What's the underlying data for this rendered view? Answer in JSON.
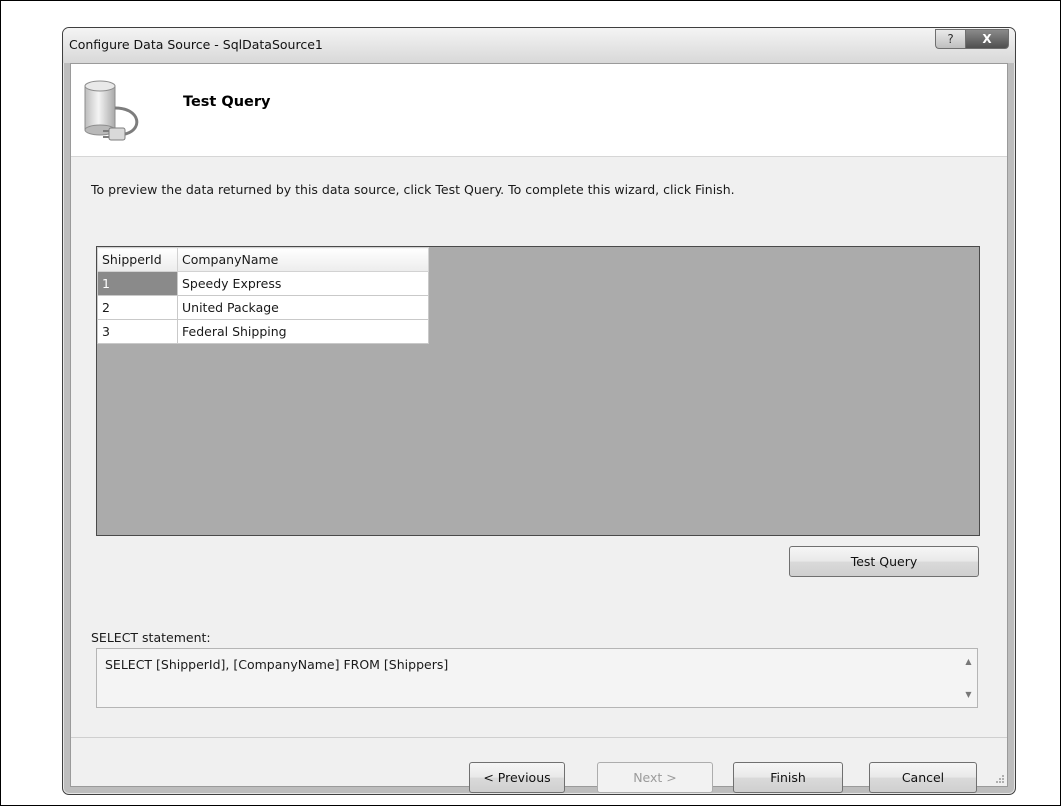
{
  "window": {
    "title": "Configure Data Source - SqlDataSource1",
    "help_label": "?",
    "close_label": "X"
  },
  "header": {
    "title": "Test Query",
    "icon": "database-plug-icon"
  },
  "instructions": "To preview the data returned by this data source, click Test Query. To complete this wizard, click Finish.",
  "grid": {
    "columns": [
      "ShipperId",
      "CompanyName"
    ],
    "rows": [
      [
        "1",
        "Speedy Express"
      ],
      [
        "2",
        "United Package"
      ],
      [
        "3",
        "Federal Shipping"
      ]
    ],
    "selected_cell": "1"
  },
  "test_query_button": "Test Query",
  "select_statement": {
    "label": "SELECT statement:",
    "value": "SELECT [ShipperId], [CompanyName] FROM [Shippers]"
  },
  "footer": {
    "previous": "< Previous",
    "next": "Next >",
    "finish": "Finish",
    "cancel": "Cancel"
  },
  "colors": {
    "window_frame": "#bdbdbd",
    "client_bg": "#f0f0f0",
    "grid_bg": "#ababab",
    "selected_cell_bg": "#8a8a8a"
  }
}
